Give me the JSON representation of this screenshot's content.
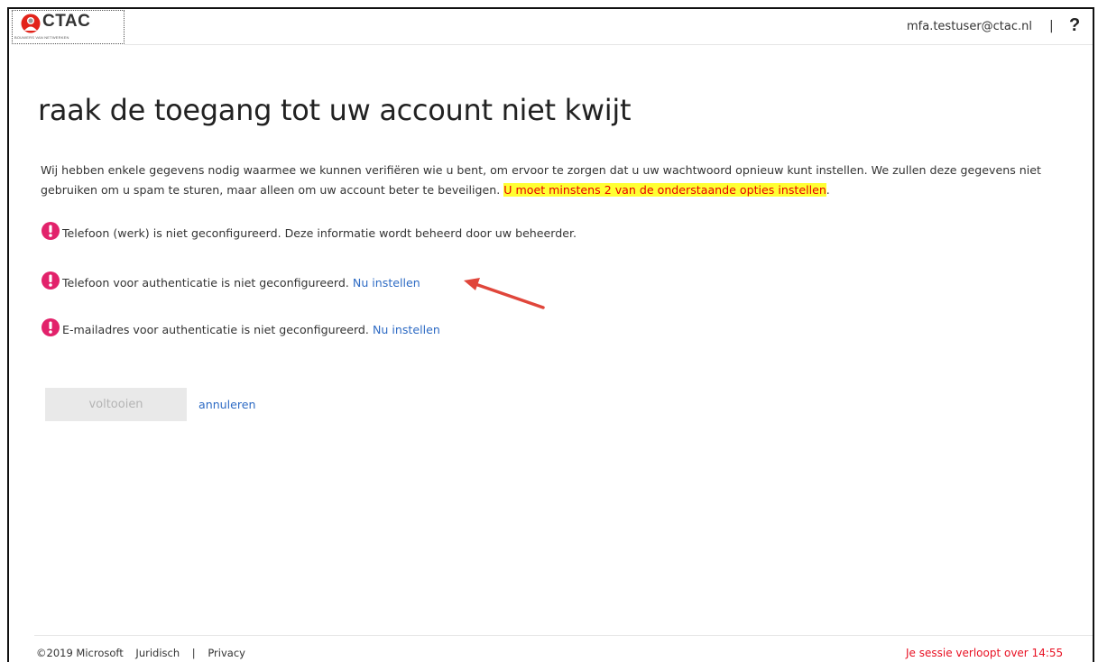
{
  "header": {
    "logo_text": "CTAC",
    "logo_tagline": "BOUWERS VAN NETWERKEN",
    "user_email": "mfa.testuser@ctac.nl",
    "separator": "|",
    "help_label": "?"
  },
  "main": {
    "title": "raak de toegang tot uw account niet kwijt",
    "intro_text": "Wij hebben enkele gegevens nodig waarmee we kunnen verifiëren wie u bent, om ervoor te zorgen dat u uw wachtwoord opnieuw kunt instellen. We zullen deze gegevens niet gebruiken om u spam te sturen, maar alleen om uw account beter te beveiligen.",
    "intro_highlight": "U moet minstens 2 van de onderstaande opties instellen",
    "intro_period": ".",
    "items": [
      {
        "text": "Telefoon (werk) is niet geconfigureerd. Deze informatie wordt beheerd door uw beheerder.",
        "link": ""
      },
      {
        "text": "Telefoon voor authenticatie is niet geconfigureerd.",
        "link": "Nu instellen"
      },
      {
        "text": "E-mailadres voor authenticatie is niet geconfigureerd.",
        "link": "Nu instellen"
      }
    ],
    "finish_label": "voltooien",
    "cancel_label": "annuleren"
  },
  "footer": {
    "copyright": "©2019 Microsoft",
    "legal_label": "Juridisch",
    "separator": "|",
    "privacy_label": "Privacy",
    "session_text": "Je sessie verloopt over 14:55"
  },
  "colors": {
    "link": "#2e6bc4",
    "warning": "#e2226b",
    "highlight_bg": "#ffff33",
    "highlight_text": "#e50000",
    "session": "#e81123",
    "annotation_arrow": "#e0463b"
  },
  "icons": {
    "warning": "exclamation-circle-icon",
    "annotation": "red-arrow-icon",
    "help": "question-mark-icon"
  }
}
